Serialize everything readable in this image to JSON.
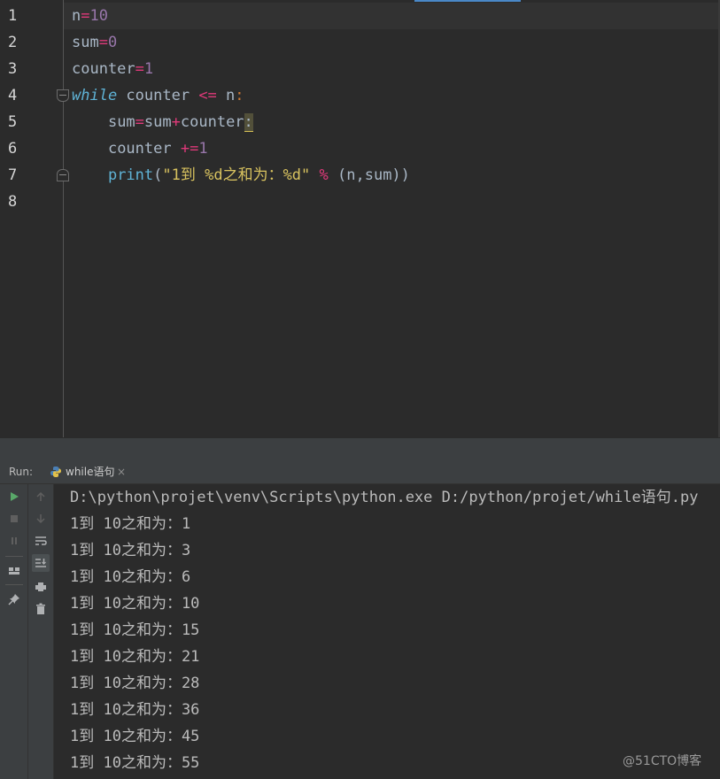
{
  "editor": {
    "line_numbers": [
      "1",
      "2",
      "3",
      "4",
      "5",
      "6",
      "7",
      "8"
    ],
    "lines": {
      "l1": {
        "a": "n",
        "b": "=",
        "c": "10"
      },
      "l2": {
        "a": "sum",
        "b": "=",
        "c": "0"
      },
      "l3": {
        "a": "counter",
        "b": "=",
        "c": "1"
      },
      "l4": {
        "kw": "while",
        "a": " counter ",
        "op": "<=",
        "b": " n",
        "colon": ":"
      },
      "l5": {
        "indent": "    ",
        "a": "sum",
        "op1": "=",
        "b": "sum",
        "op2": "+",
        "c": "counter",
        "colon": ":"
      },
      "l6": {
        "indent": "    ",
        "a": "counter ",
        "op": "+=",
        "c": "1"
      },
      "l7": {
        "indent": "    ",
        "fn": "print",
        "p1": "(",
        "str": "\"1到 %d之和为：%d\"",
        "sp1": " ",
        "pct": "%",
        "args": " (n,sum))"
      }
    }
  },
  "run_panel": {
    "label": "Run:",
    "tab": {
      "label": "while语句",
      "close": "×",
      "icon": "python-icon"
    },
    "command": "D:\\python\\projet\\venv\\Scripts\\python.exe D:/python/projet/while语句.py",
    "output": [
      "1到 10之和为：1",
      "1到 10之和为：3",
      "1到 10之和为：6",
      "1到 10之和为：10",
      "1到 10之和为：15",
      "1到 10之和为：21",
      "1到 10之和为：28",
      "1到 10之和为：36",
      "1到 10之和为：45",
      "1到 10之和为：55"
    ],
    "toolbar_left": [
      "run-icon",
      "stop-icon",
      "pause-icon",
      "layout-icon",
      "pin-icon"
    ],
    "toolbar_right": [
      "up-arrow-icon",
      "down-arrow-icon",
      "soft-wrap-icon",
      "scroll-to-end-icon",
      "print-icon",
      "trash-icon"
    ]
  },
  "watermark": "@51CTO博客",
  "colors": {
    "background": "#2b2b2b",
    "panel": "#3c3f41",
    "keyword": "#cc7832",
    "number": "#9876aa",
    "string": "#d8c25f",
    "builtin": "#5fb3d6",
    "text": "#a9b7c6",
    "run_green": "#59a869"
  }
}
